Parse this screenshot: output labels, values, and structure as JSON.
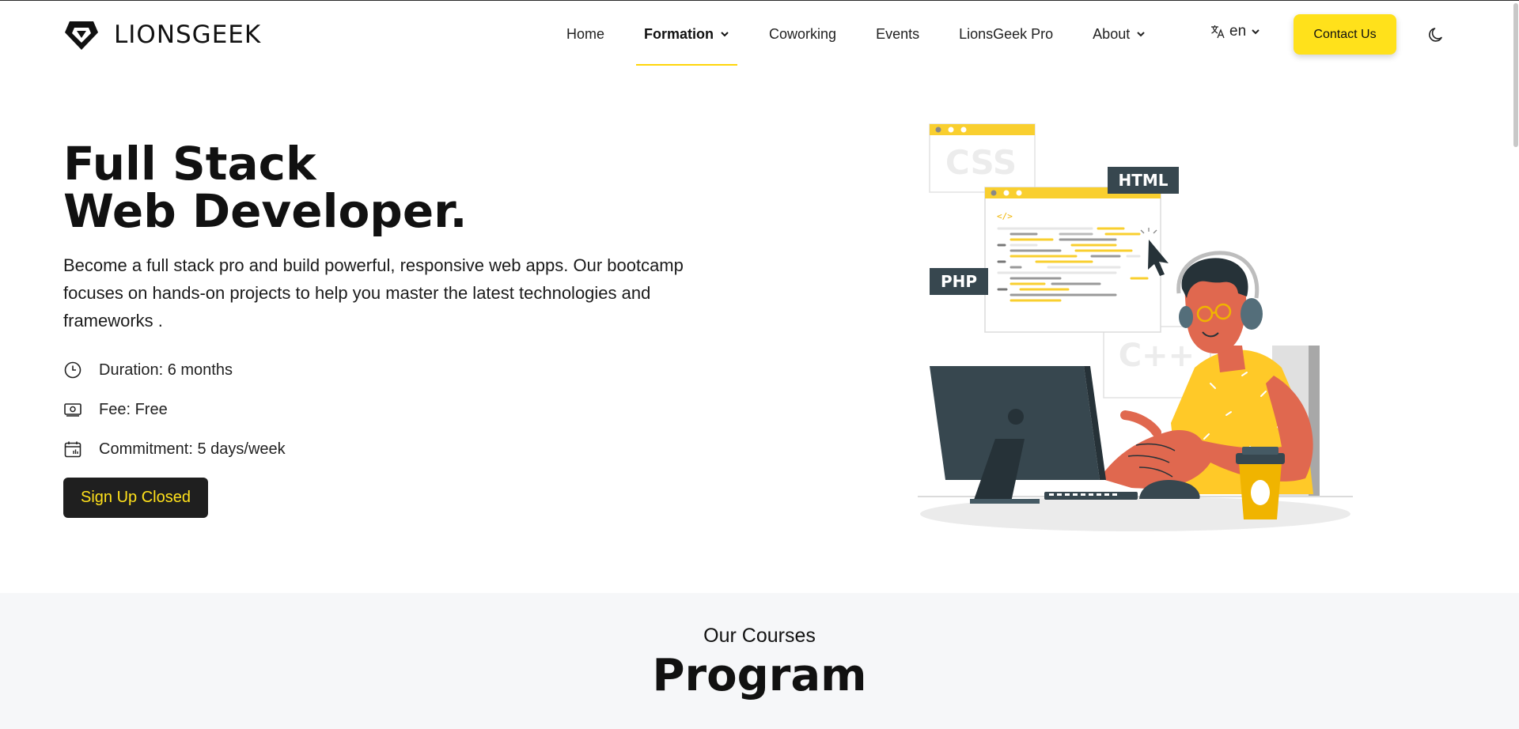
{
  "brand": {
    "name": "LIONSGEEK"
  },
  "nav": {
    "items": [
      {
        "label": "Home"
      },
      {
        "label": "Formation",
        "active": true,
        "dropdown": true
      },
      {
        "label": "Coworking"
      },
      {
        "label": "Events"
      },
      {
        "label": "LionsGeek Pro"
      },
      {
        "label": "About",
        "dropdown": true
      }
    ],
    "language": "en",
    "contact_label": "Contact Us",
    "theme_icon": "moon-icon"
  },
  "hero": {
    "title_line1": "Full Stack",
    "title_line2": "Web Developer.",
    "description": "Become a full stack pro and build powerful, responsive web apps. Our bootcamp focuses on hands-on projects to help you master the latest technologies and frameworks .",
    "facts": [
      {
        "icon": "clock-icon",
        "text": "Duration: 6 months"
      },
      {
        "icon": "money-icon",
        "text": "Fee: Free"
      },
      {
        "icon": "calendar-icon",
        "text": "Commitment: 5 days/week"
      }
    ],
    "signup_label": "Sign Up Closed",
    "illustration_labels": {
      "css": "CSS",
      "html": "HTML",
      "php": "PHP",
      "cpp": "C++"
    }
  },
  "courses": {
    "subtitle": "Our Courses",
    "title": "Program"
  },
  "colors": {
    "accent": "#ffe11b",
    "dark": "#1f1f1f",
    "slate": "#37474f",
    "skin": "#e0684f",
    "section_bg": "#f6f7f9"
  }
}
